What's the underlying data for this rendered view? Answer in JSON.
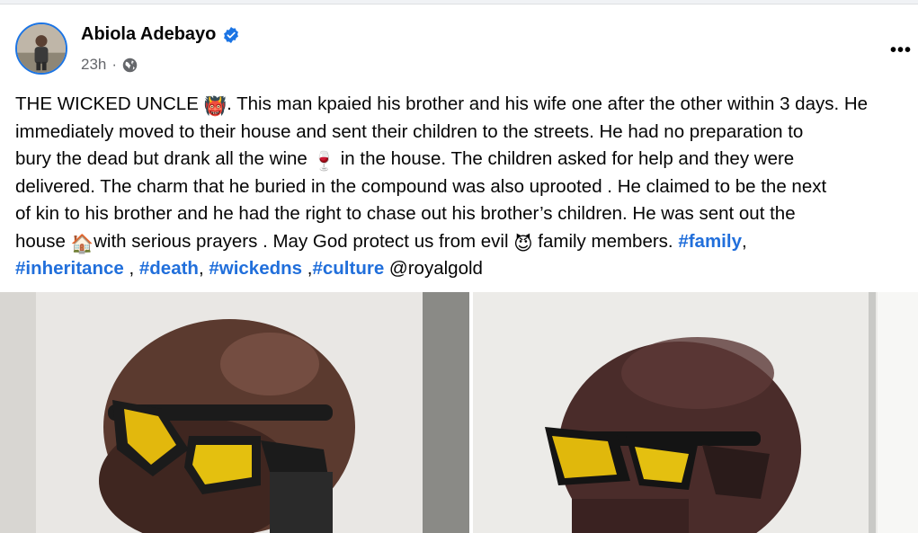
{
  "post": {
    "author": "Abiola Adebayo",
    "time": "23h",
    "separator": "·",
    "more_label": "•••",
    "text_lines": [
      [
        "THE WICKED UNCLE ",
        "👹",
        ". This man kpaied his brother and his wife one after the other within 3 days. He"
      ],
      [
        "immediately moved to their house and sent their children to the streets. He had no preparation to"
      ],
      [
        "bury the dead but drank all the wine ",
        "🍷",
        " in the house. The children asked for help and they were"
      ],
      [
        "delivered. The charm that he buried in the compound was also uprooted . He claimed to be the next"
      ],
      [
        "of kin to his brother and he had the right to chase out his brother’s children. He was sent out the"
      ],
      [
        "house ",
        "🏠",
        "with serious prayers . May God  protect us from evil ",
        "😈",
        " family members. "
      ]
    ],
    "hashtags": {
      "family": "#family",
      "inheritance": "#inheritance",
      "death": "#death",
      "wickedness": "#wickedns",
      "culture": "#culture"
    },
    "mention": "@royalgold",
    "colors": {
      "hashtag": "#216fdb",
      "verified": "#1b74e4",
      "meta": "#65676b"
    },
    "icons": [
      "verified-badge-icon",
      "globe-icon",
      "more-options-icon"
    ]
  }
}
